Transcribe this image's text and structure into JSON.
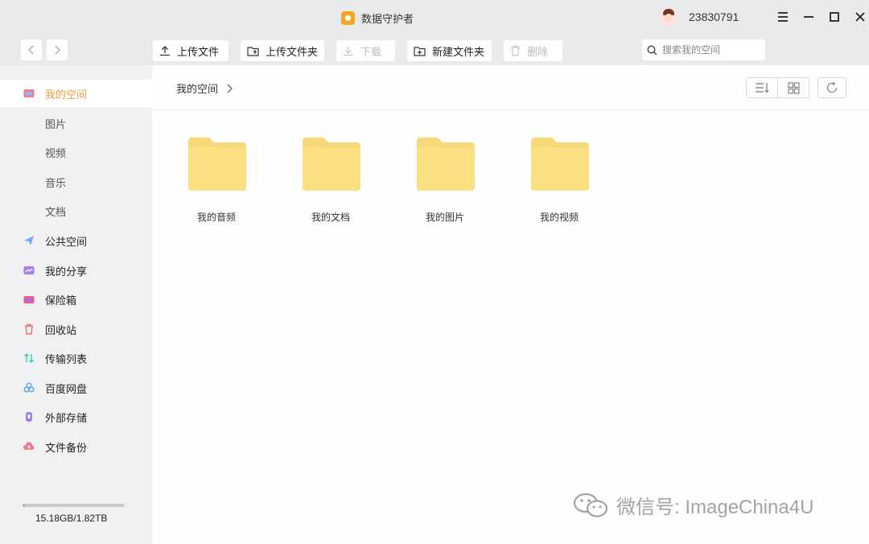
{
  "titlebar": {
    "app_title": "数据守护者",
    "app_icon": "shield-app-icon",
    "user_id": "23830791"
  },
  "toolbar": {
    "upload_file": "上传文件",
    "upload_folder": "上传文件夹",
    "download": "下载",
    "new_folder": "新建文件夹",
    "delete": "删除",
    "search_placeholder": "搜索我的空间"
  },
  "sidebar": {
    "items": [
      {
        "label": "我的空间",
        "icon": "my-space-icon",
        "active": true
      },
      {
        "label": "图片",
        "sub": true
      },
      {
        "label": "视频",
        "sub": true
      },
      {
        "label": "音乐",
        "sub": true
      },
      {
        "label": "文档",
        "sub": true
      },
      {
        "label": "公共空间",
        "icon": "public-space-icon"
      },
      {
        "label": "我的分享",
        "icon": "share-icon"
      },
      {
        "label": "保险箱",
        "icon": "safe-box-icon"
      },
      {
        "label": "回收站",
        "icon": "recycle-bin-icon"
      },
      {
        "label": "传输列表",
        "icon": "transfer-icon"
      },
      {
        "label": "百度网盘",
        "icon": "baidu-netdisk-icon"
      },
      {
        "label": "外部存储",
        "icon": "external-storage-icon"
      },
      {
        "label": "文件备份",
        "icon": "backup-icon"
      }
    ],
    "storage_text": "15.18GB/1.82TB",
    "storage_used_fraction": 0.0081
  },
  "main": {
    "breadcrumb": "我的空间",
    "folders": [
      {
        "name": "我的音频"
      },
      {
        "name": "我的文档"
      },
      {
        "name": "我的图片"
      },
      {
        "name": "我的视频"
      }
    ]
  },
  "watermark": {
    "text": "微信号: ImageChina4U"
  },
  "colors": {
    "accent": "#f0a03c",
    "folder": "#fbd97a",
    "folder_tab": "#f5cf6a",
    "chrome": "#e9eaec",
    "sidebar": "#f0f1f3"
  }
}
